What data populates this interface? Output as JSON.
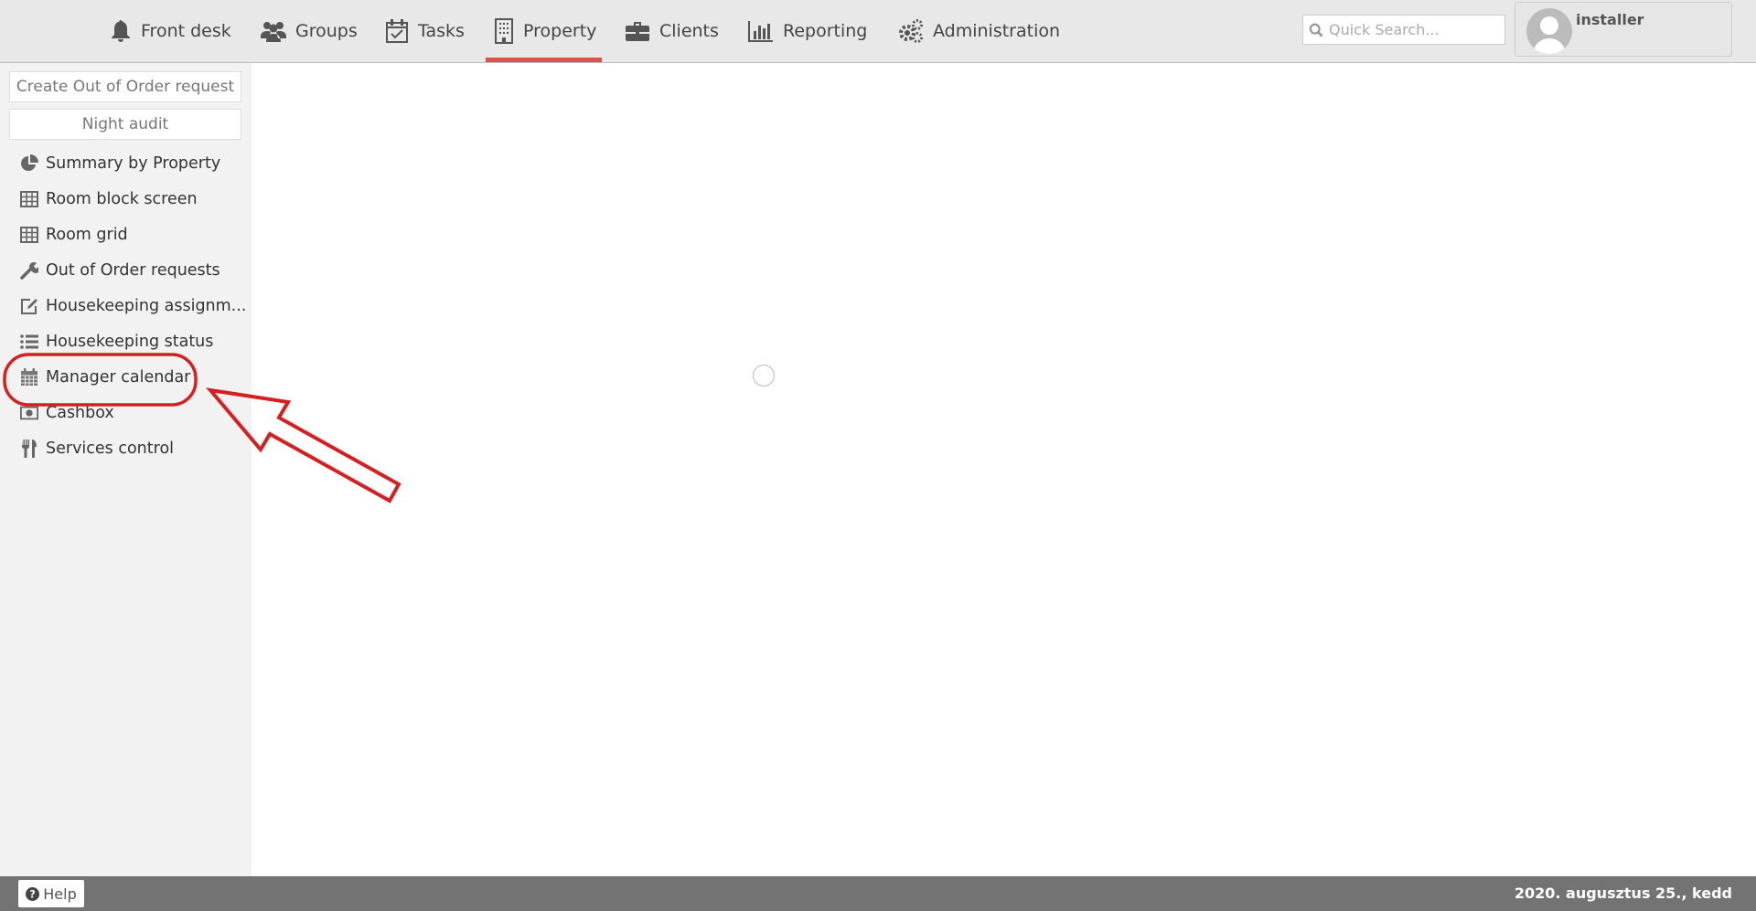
{
  "nav": {
    "items": [
      {
        "label": "Front desk",
        "icon": "bell-icon"
      },
      {
        "label": "Groups",
        "icon": "users-icon"
      },
      {
        "label": "Tasks",
        "icon": "calendar-check-icon"
      },
      {
        "label": "Property",
        "icon": "building-icon",
        "active": true
      },
      {
        "label": "Clients",
        "icon": "briefcase-icon"
      },
      {
        "label": "Reporting",
        "icon": "bar-chart-icon"
      },
      {
        "label": "Administration",
        "icon": "gears-icon"
      }
    ],
    "active_color": "#d9534f"
  },
  "search": {
    "placeholder": "Quick Search..."
  },
  "user": {
    "name": "installer"
  },
  "sidebar": {
    "buttons": [
      "Create Out of Order request",
      "Night audit"
    ],
    "items": [
      {
        "label": "Summary by Property",
        "icon": "pie-chart-icon"
      },
      {
        "label": "Room block screen",
        "icon": "table-icon"
      },
      {
        "label": "Room grid",
        "icon": "table-icon"
      },
      {
        "label": "Out of Order requests",
        "icon": "wrench-icon"
      },
      {
        "label": "Housekeeping assignm...",
        "icon": "edit-icon"
      },
      {
        "label": "Housekeeping status",
        "icon": "list-icon"
      },
      {
        "label": "Manager calendar",
        "icon": "calendar-icon",
        "highlighted": true
      },
      {
        "label": "Cashbox",
        "icon": "money-icon"
      },
      {
        "label": "Services control",
        "icon": "cutlery-icon"
      }
    ]
  },
  "footer": {
    "help_label": "Help",
    "date": "2020. augusztus 25., kedd"
  },
  "annotation_color": "#d42020"
}
